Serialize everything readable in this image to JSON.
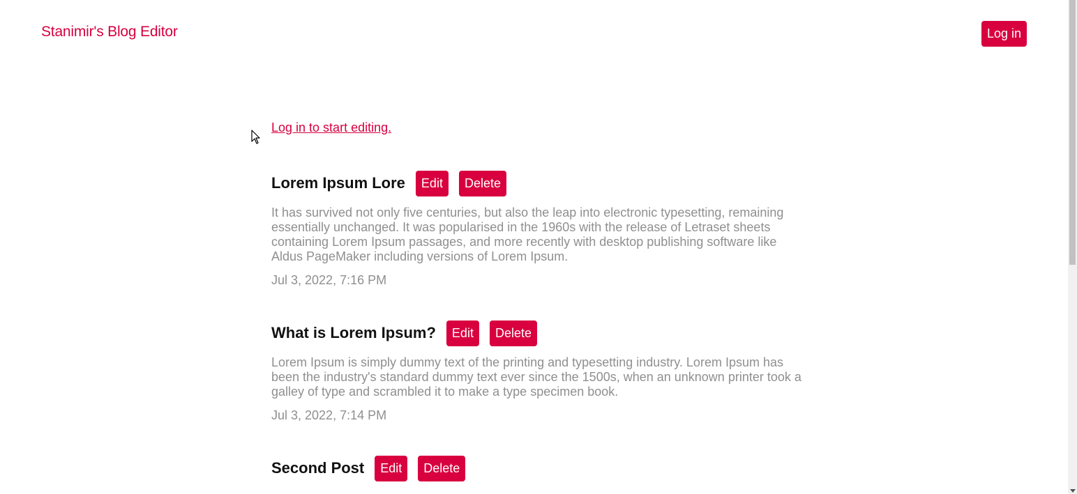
{
  "header": {
    "title": "Stanimir's Blog Editor",
    "login_label": "Log in"
  },
  "prompt": {
    "text": "Log in to start editing."
  },
  "actions": {
    "edit_label": "Edit",
    "delete_label": "Delete"
  },
  "posts": [
    {
      "title": "Lorem Ipsum Lore",
      "body": "It has survived not only five centuries, but also the leap into electronic typesetting, remaining essentially unchanged. It was popularised in the 1960s with the release of Letraset sheets containing Lorem Ipsum passages, and more recently with desktop publishing software like Aldus PageMaker including versions of Lorem Ipsum.",
      "date": "Jul 3, 2022, 7:16 PM"
    },
    {
      "title": "What is Lorem Ipsum?",
      "body": "Lorem Ipsum is simply dummy text of the printing and typesetting industry. Lorem Ipsum has been the industry's standard dummy text ever since the 1500s, when an unknown printer took a galley of type and scrambled it to make a type specimen book.",
      "date": "Jul 3, 2022, 7:14 PM"
    },
    {
      "title": "Second Post",
      "body": "",
      "date": ""
    }
  ],
  "colors": {
    "accent": "#d9003f",
    "muted_text": "#8f8f8f"
  }
}
